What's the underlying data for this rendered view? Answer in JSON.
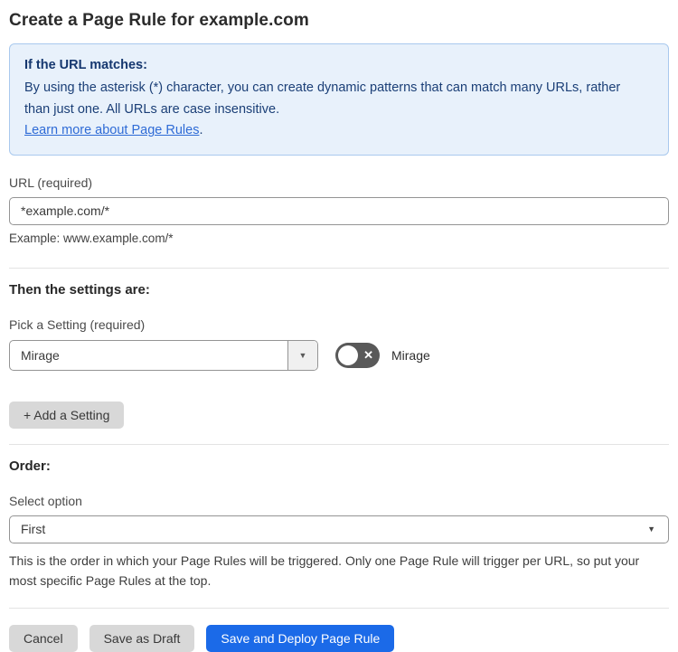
{
  "page": {
    "title": "Create a Page Rule for example.com"
  },
  "info_box": {
    "heading": "If the URL matches:",
    "body": "By using the asterisk (*) character, you can create dynamic patterns that can match many URLs, rather than just one. All URLs are case insensitive.",
    "link": "Learn more about Page Rules",
    "link_suffix": "."
  },
  "url_field": {
    "label": "URL (required)",
    "value": "*example.com/*",
    "example": "Example: www.example.com/*"
  },
  "settings": {
    "heading": "Then the settings are:",
    "picker_label": "Pick a Setting (required)",
    "selected_setting": "Mirage",
    "dropdown_arrow": "▼",
    "toggle": {
      "label": "Mirage",
      "state": "off",
      "off_glyph": "✕"
    },
    "add_button": "+ Add a Setting"
  },
  "order": {
    "heading": "Order:",
    "select_label": "Select option",
    "selected_option": "First",
    "select_arrow": "▼",
    "help": "This is the order in which your Page Rules will be triggered. Only one Page Rule will trigger per URL, so put your most specific Page Rules at the top."
  },
  "footer": {
    "cancel": "Cancel",
    "save_draft": "Save as Draft",
    "save_deploy": "Save and Deploy Page Rule"
  },
  "colors": {
    "info_bg": "#e8f1fb",
    "info_border": "#a9c9ee",
    "info_text": "#1b3f77",
    "link": "#2e6bd6",
    "primary_button": "#1b6ae8",
    "toggle_off": "#595959",
    "secondary_button": "#d8d8d8"
  }
}
